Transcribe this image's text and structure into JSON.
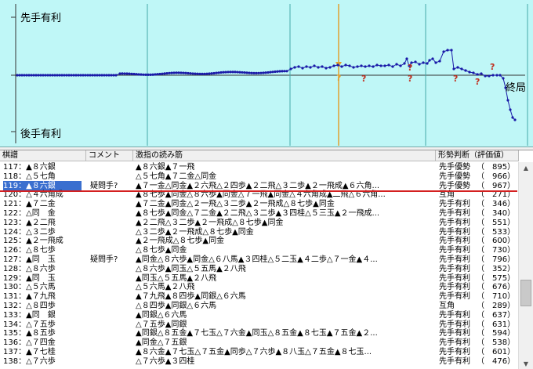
{
  "graph": {
    "top_label": "先手有利",
    "bottom_label": "後手有利",
    "end_label": "終局",
    "colors": {
      "background": "#bff7f7",
      "line": "#1a1aa8",
      "cursor": "#e0a030",
      "mark_q": "#c03020"
    }
  },
  "list": {
    "headers": {
      "move": "棋譜",
      "comment": "コメント",
      "reading": "激指の読み筋",
      "judgment": "形勢判断（評価値）"
    },
    "rows": [
      {
        "move": "117：▲８六銀",
        "comment": "",
        "reading": "▲８六銀▲７一飛",
        "judgment": "先手優勢",
        "value": "（　895）"
      },
      {
        "move": "118：△５七角",
        "comment": "",
        "reading": "△５七角▲７二金△同金",
        "judgment": "先手優勢",
        "value": "（　966）"
      },
      {
        "move": "119：▲８六銀",
        "comment": "疑問手?",
        "reading": "▲７一金△同金▲２六飛△２四歩▲２二飛△３二歩▲２一飛成▲６六角...",
        "judgment": "先手優勢",
        "value": "（　967）",
        "selected": true
      },
      {
        "move": "120：△４六角成",
        "comment": "",
        "reading": "▲８七歩▲同金△８六歩▲同金△７一飛▲同金△４六角成▲二飛△６六角...",
        "judgment": "互角",
        "value": "（　271）"
      },
      {
        "move": "121：▲７二金",
        "comment": "",
        "reading": "▲７二金▲同金△２一飛△３二歩▲２一飛成△８七歩▲同金",
        "judgment": "先手有利",
        "value": "（　346）"
      },
      {
        "move": "122：△同　金",
        "comment": "",
        "reading": "▲８七歩▲同金△７二金▲２二飛△３二歩▲３四桂△５三玉▲２一飛成...",
        "judgment": "先手有利",
        "value": "（　340）"
      },
      {
        "move": "123：▲２二飛",
        "comment": "",
        "reading": "▲２二飛△３二歩▲２一飛成△８七歩▲同金",
        "judgment": "先手有利",
        "value": "（　551）"
      },
      {
        "move": "124：△３二歩",
        "comment": "",
        "reading": "△３二歩▲２一飛成△８七歩▲同金",
        "judgment": "先手有利",
        "value": "（　533）"
      },
      {
        "move": "125：▲２一飛成",
        "comment": "",
        "reading": "▲２一飛成△８七歩▲同金",
        "judgment": "先手有利",
        "value": "（　600）"
      },
      {
        "move": "126：△８七歩",
        "comment": "",
        "reading": "△８七歩▲同金",
        "judgment": "先手有利",
        "value": "（　730）"
      },
      {
        "move": "127：▲同　玉",
        "comment": "疑問手?",
        "reading": "▲同金△８六歩▲同金△６八馬▲３四桂△５二玉▲４二歩△７一金▲４...",
        "judgment": "先手有利",
        "value": "（　796）"
      },
      {
        "move": "128：△８六歩",
        "comment": "",
        "reading": "△８六歩▲同玉△５五馬▲２八飛",
        "judgment": "先手有利",
        "value": "（　352）"
      },
      {
        "move": "129：▲同　玉",
        "comment": "",
        "reading": "▲同玉△５五馬▲２八飛",
        "judgment": "先手有利",
        "value": "（　575）"
      },
      {
        "move": "130：△５六馬",
        "comment": "",
        "reading": "△５六馬▲２八飛",
        "judgment": "先手有利",
        "value": "（　676）"
      },
      {
        "move": "131：▲７九飛",
        "comment": "",
        "reading": "▲７九飛▲８四歩▲同銀△６六馬",
        "judgment": "先手有利",
        "value": "（　710）"
      },
      {
        "move": "132：△８四歩",
        "comment": "",
        "reading": "△８四歩▲同銀△６六馬",
        "judgment": "互角",
        "value": "（　289）"
      },
      {
        "move": "133：▲同　銀",
        "comment": "",
        "reading": "▲同銀△６六馬",
        "judgment": "先手有利",
        "value": "（　637）"
      },
      {
        "move": "134：△７五歩",
        "comment": "",
        "reading": "△７五歩▲同銀",
        "judgment": "先手有利",
        "value": "（　631）"
      },
      {
        "move": "135：▲８五歩",
        "comment": "",
        "reading": "▲同銀△８五金▲７七玉△７六金▲同玉△８五金▲８七玉▲７五金▲２...",
        "judgment": "先手有利",
        "value": "（　594）"
      },
      {
        "move": "136：△７四金",
        "comment": "",
        "reading": "▲同金△７五銀",
        "judgment": "先手有利",
        "value": "（　538）"
      },
      {
        "move": "137：▲７七桂",
        "comment": "",
        "reading": "▲８六金▲７七玉△７五金▲同歩△７六歩▲８八玉△７五金▲８七玉...",
        "judgment": "先手有利",
        "value": "（　601）"
      },
      {
        "move": "138：△７六歩",
        "comment": "",
        "reading": "△７六歩▲３四桂",
        "judgment": "先手有利",
        "value": "（　476）"
      }
    ]
  }
}
